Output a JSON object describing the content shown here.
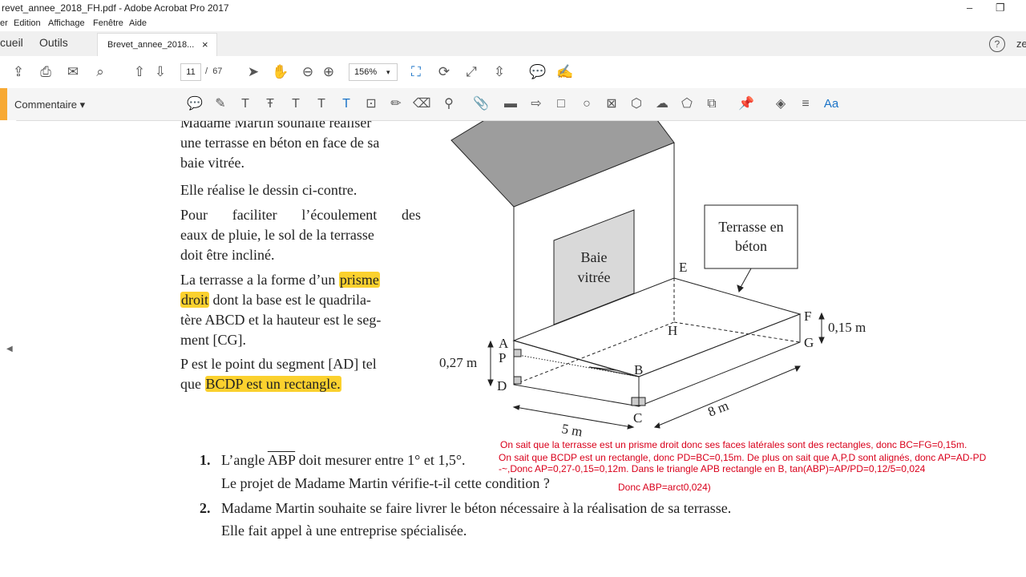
{
  "window": {
    "title": "revet_annee_2018_FH.pdf - Adobe Acrobat Pro 2017",
    "minimize": "–",
    "restore": "❐"
  },
  "menu": [
    "er",
    "Edition",
    "Affichage",
    "Fenêtre",
    "Aide"
  ],
  "tabs": {
    "home": "cueil",
    "tools": "Outils",
    "doc": "Brevet_annee_2018...",
    "close": "×",
    "help": "?",
    "user": "ze"
  },
  "toolbar": {
    "page_current": "11",
    "page_sep": "/",
    "page_total": "67",
    "zoom": "156%",
    "zoom_caret": "▾"
  },
  "comment_bar": {
    "label": "Commentaire ▾",
    "font_label": "Aa"
  },
  "document": {
    "para1": [
      "Madame Martin souhaite réaliser",
      "une terrasse en béton en face de sa",
      "baie vitrée."
    ],
    "para2": "Elle réalise le dessin ci-contre.",
    "para3": [
      "Pour faciliter l’écoulement des",
      "eaux de pluie, le sol de la terrasse",
      "doit être incliné."
    ],
    "para4": {
      "l1a": "La terrasse a la forme d’un ",
      "l1b": "prisme",
      "l2a": "droit",
      "l2b": " dont la base est le quadrila-",
      "l3": "tère ABCD et la hauteur est le seg-",
      "l4": "ment [CG]."
    },
    "para5": {
      "l1": "P est le point du segment [AD] tel",
      "l2a": "que ",
      "l2b": "BCDP est un rectangle."
    },
    "figure": {
      "callout": [
        "Terrasse en",
        "béton"
      ],
      "window": [
        "Baie",
        "vitrée"
      ],
      "points": {
        "A": "A",
        "P": "P",
        "D": "D",
        "B": "B",
        "C": "C",
        "E": "E",
        "H": "H",
        "F": "F",
        "G": "G"
      },
      "dims": {
        "height": "0,27 m",
        "thickness": "0,15 m",
        "width": "5 m",
        "length": "8 m"
      }
    },
    "q1": {
      "num": "1.",
      "line1a": "L’angle ",
      "angle": "ABP",
      "line1b": " doit mesurer entre 1° et 1,5°.",
      "line2": "Le projet de Madame Martin vérifie-t-il cette condition ?"
    },
    "q2": {
      "num": "2.",
      "line1": "Madame Martin souhaite se faire livrer le béton nécessaire à la réalisation de sa terrasse.",
      "line2": "Elle fait appel à une entreprise spécialisée."
    },
    "annotations": [
      "On sait que la terrasse est un prisme droit donc ses faces latérales sont des rectangles, donc BC=FG=0,15m.",
      "On sait que BCDP est un rectangle, donc PD=BC=0,15m. De plus on sait que A,P,D sont alignés, donc AP=AD-PD",
      "-~,Donc AP=0,27-0,15=0,12m. Dans le triangle APB rectangle en B, tan(ABP)=AP/PD=0,12/5=0,024",
      "Donc ABP=arct0,024)"
    ]
  }
}
